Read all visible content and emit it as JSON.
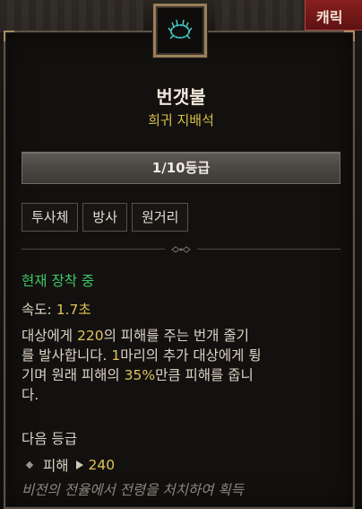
{
  "header": {
    "character_tab": "캐릭"
  },
  "item": {
    "icon": "thorn-wreath-icon",
    "name": "번갯불",
    "rarity_type": "희귀 지배석",
    "rank": "1/10등급",
    "tags": [
      "투사체",
      "방사",
      "원거리"
    ]
  },
  "status": {
    "equipped": "현재 장착 중",
    "speed_label": "속도:",
    "speed_value": "1.7초"
  },
  "description": {
    "l1a": "대상에게 ",
    "l1n": "220",
    "l1b": "의 피해를 주는 번개 줄기",
    "l2a": "를 발사합니다. ",
    "l2n": "1",
    "l2b": "마리의 추가 대상에게 튕",
    "l3a": "기며 원래 피해의 ",
    "l3n": "35%",
    "l3b": "만큼 피해를 줍니",
    "l4": "다."
  },
  "next_rank": {
    "heading": "다음 등급",
    "stat_label": "피해",
    "stat_value": "240",
    "source": "비전의 전율에서 전령을 처치하여 획득"
  },
  "colors": {
    "title": "#efe6da",
    "rarity": "#d8c04b",
    "equipped": "#3fc764",
    "highlight": "#e0c35a",
    "muted": "#8d857c"
  }
}
